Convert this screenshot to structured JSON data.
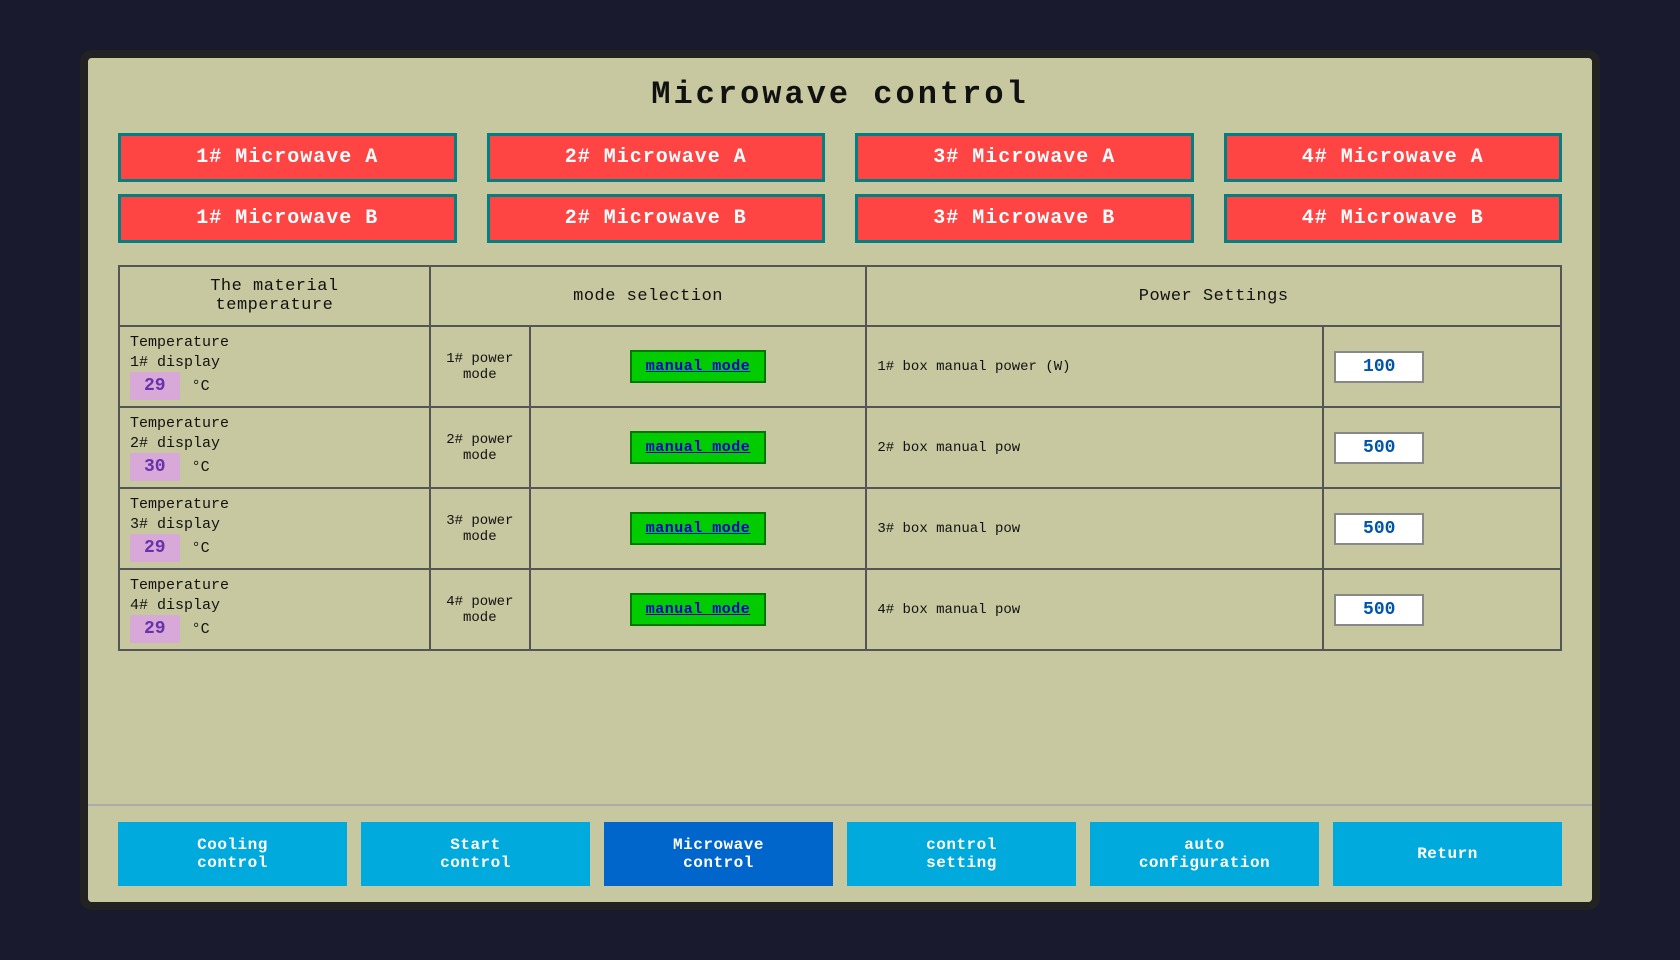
{
  "title": "Microwave control",
  "microwave_a_buttons": [
    "1# Microwave A",
    "2# Microwave A",
    "3# Microwave A",
    "4# Microwave A"
  ],
  "microwave_b_buttons": [
    "1# Microwave B",
    "2# Microwave B",
    "3# Microwave B",
    "4# Microwave B"
  ],
  "table_headers": {
    "col1": "The material\ntemperature",
    "col2": "mode selection",
    "col3": "Power Settings"
  },
  "rows": [
    {
      "temp_label": "Temperature\n1# display",
      "temp_value": "29",
      "unit": "°C",
      "power_label": "1# power\nmode",
      "mode_btn": "manual mode",
      "power_setting_label": "1# box manual power",
      "power_unit": "(W)",
      "power_value": "100"
    },
    {
      "temp_label": "Temperature\n2# display",
      "temp_value": "30",
      "unit": "°C",
      "power_label": "2# power\nmode",
      "mode_btn": "manual mode",
      "power_setting_label": "2# box manual pow",
      "power_unit": "",
      "power_value": "500"
    },
    {
      "temp_label": "Temperature\n3# display",
      "temp_value": "29",
      "unit": "°C",
      "power_label": "3# power\nmode",
      "mode_btn": "manual mode",
      "power_setting_label": "3# box manual pow",
      "power_unit": "",
      "power_value": "500"
    },
    {
      "temp_label": "Temperature\n4# display",
      "temp_value": "29",
      "unit": "°C",
      "power_label": "4# power\nmode",
      "mode_btn": "manual mode",
      "power_setting_label": "4# box manual pow",
      "power_unit": "",
      "power_value": "500"
    }
  ],
  "nav_buttons": [
    {
      "label": "Cooling\ncontrol",
      "active": false
    },
    {
      "label": "Start\ncontrol",
      "active": false
    },
    {
      "label": "Microwave\ncontrol",
      "active": true
    },
    {
      "label": "control\nsetting",
      "active": false
    },
    {
      "label": "auto\nconfiguration",
      "active": false
    },
    {
      "label": "Return",
      "active": false
    }
  ]
}
